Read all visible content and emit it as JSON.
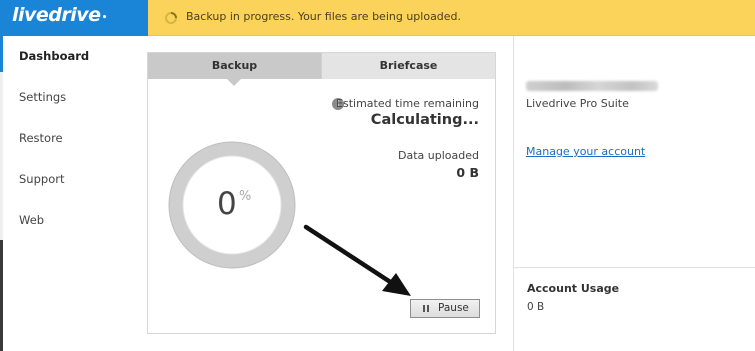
{
  "brand": {
    "logo_text": "livedrive",
    "logo_dot": "•",
    "bar_color": "#1a84d6"
  },
  "notification": {
    "text": "Backup in progress. Your files are being uploaded.",
    "bar_color": "#fbd35a",
    "icon": "spinner-icon"
  },
  "sidebar": {
    "items": [
      {
        "label": "Dashboard",
        "active": true
      },
      {
        "label": "Settings",
        "active": false
      },
      {
        "label": "Restore",
        "active": false
      },
      {
        "label": "Support",
        "active": false
      },
      {
        "label": "Web",
        "active": false
      }
    ]
  },
  "main": {
    "tabs": [
      {
        "label": "Backup",
        "active": true
      },
      {
        "label": "Briefcase",
        "active": false
      }
    ],
    "estimated_label": "Estimated time remaining",
    "estimated_value": "Calculating...",
    "data_label": "Data uploaded",
    "data_value": "0 B",
    "progress": {
      "value": "0",
      "unit": "%",
      "fraction": 0
    },
    "pause_label": "Pause"
  },
  "account": {
    "plan_name": "Livedrive Pro Suite",
    "manage_link": "Manage your account",
    "usage_title": "Account Usage",
    "usage_value": "0 B",
    "link_color": "#1a6fc4"
  }
}
